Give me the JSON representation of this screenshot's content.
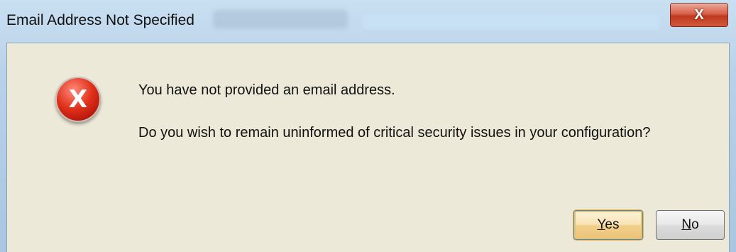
{
  "window": {
    "title": "Email Address Not Specified",
    "close_glyph": "X"
  },
  "dialog": {
    "icon": "error-icon",
    "icon_glyph": "X",
    "message_line1": "You have not provided an email address.",
    "message_line2": "Do you wish to remain uninformed of critical security issues in your configuration?"
  },
  "buttons": {
    "yes_mnemonic": "Y",
    "yes_rest": "es",
    "no_mnemonic": "N",
    "no_rest": "o"
  },
  "colors": {
    "dialog_background": "#ece9d8",
    "error_red": "#e0301a",
    "close_red": "#c0391f",
    "default_button_border": "#3b8ec4"
  }
}
